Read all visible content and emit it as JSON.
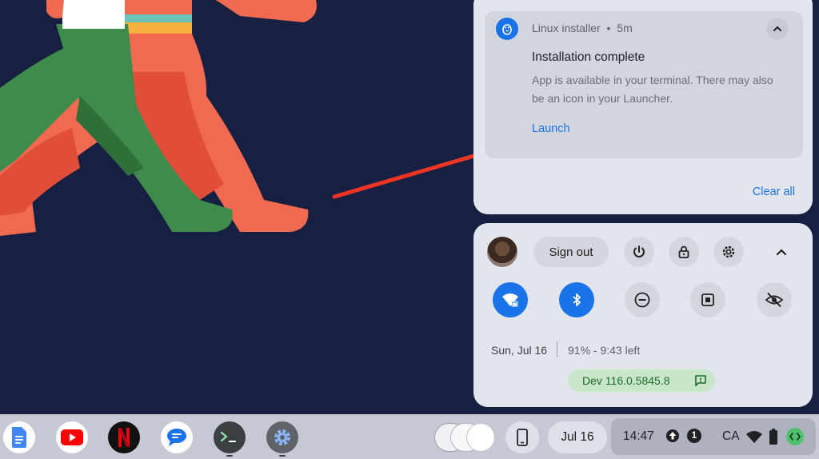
{
  "notification": {
    "app_name": "Linux installer",
    "separator": "•",
    "time_ago": "5m",
    "title": "Installation complete",
    "body": "App is available in your terminal. There may also be an icon in your Launcher.",
    "action_label": "Launch",
    "clear_all_label": "Clear all",
    "app_icon": "linux-penguin-icon",
    "collapse_icon": "chevron-up-icon"
  },
  "quick_settings": {
    "sign_out_label": "Sign out",
    "top_buttons": [
      "power-icon",
      "lock-icon",
      "gear-icon",
      "chevron-up-icon"
    ],
    "toggles": [
      {
        "icon": "wifi-lock-icon",
        "active": true
      },
      {
        "icon": "bluetooth-icon",
        "active": true
      },
      {
        "icon": "do-not-disturb-icon",
        "active": false
      },
      {
        "icon": "screen-capture-icon",
        "active": false
      },
      {
        "icon": "privacy-eye-off-icon",
        "active": false
      }
    ],
    "date": "Sun, Jul 16",
    "battery_status": "91% - 9:43 left",
    "version": "Dev 116.0.5845.8",
    "feedback_icon": "feedback-icon"
  },
  "shelf": {
    "apps": [
      "google-docs-icon",
      "youtube-icon",
      "netflix-icon",
      "messages-icon",
      "terminal-icon",
      "settings-icon"
    ],
    "date": "Jul 16",
    "time": "14:47",
    "locale": "CA",
    "tray_icons": [
      "update-icon",
      "notification-count-icon",
      "wifi-icon",
      "battery-icon",
      "developer-icon"
    ],
    "notification_count": "1"
  },
  "colors": {
    "accent": "#1a73e8",
    "wallpaper_bg": "#172040",
    "arrow": "#ee3524"
  }
}
